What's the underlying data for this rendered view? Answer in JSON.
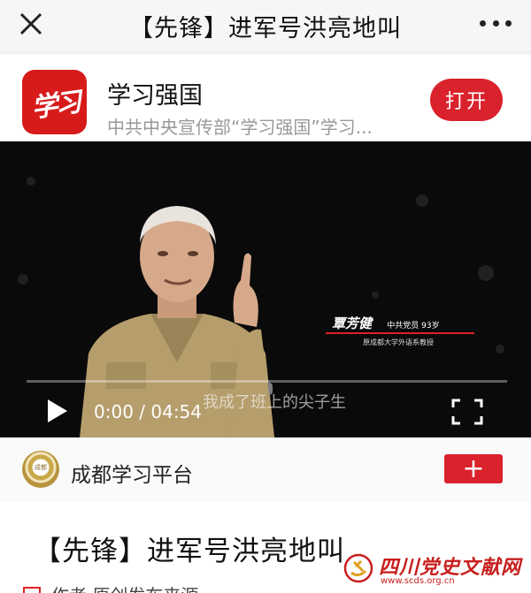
{
  "navbar": {
    "title": "【先锋】进军号洪亮地叫"
  },
  "app_banner": {
    "logo_text": "学习",
    "name": "学习强国",
    "description": "中共中央宣传部“学习强国”学习...",
    "open_label": "打开"
  },
  "video": {
    "caption_name": "覃芳健",
    "caption_title": "中共党员 93岁",
    "caption_sub": "原成都大学外语系教授",
    "subtitle": "我成了班上的尖子生",
    "time_display": "0:00 / 04:54",
    "progress_fraction": 0.0
  },
  "source": {
    "name": "成都学习平台",
    "logo_text": "成都",
    "follow_label": "+"
  },
  "article": {
    "title": "【先锋】进军号洪亮地叫",
    "meta": "作者 原创发布来源"
  },
  "watermark": {
    "text": "四川党史文献网",
    "url": "www.scds.org.cn"
  },
  "colors": {
    "accent_red": "#d9222c",
    "logo_red": "#d71a1a"
  }
}
